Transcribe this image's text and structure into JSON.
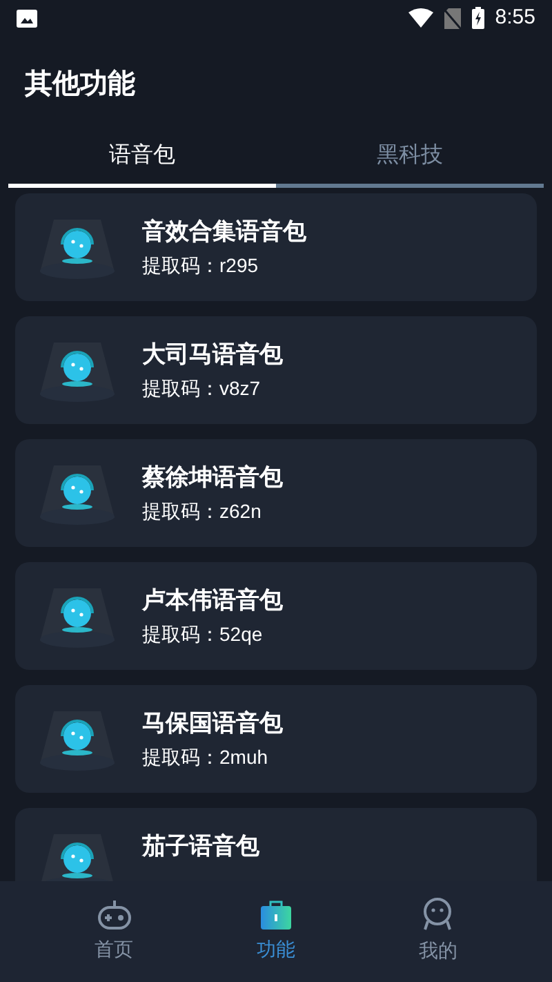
{
  "status_bar": {
    "time": "8:55"
  },
  "title": "其他功能",
  "tabs": [
    {
      "label": "语音包",
      "selected": true
    },
    {
      "label": "黑科技",
      "selected": false
    }
  ],
  "items": [
    {
      "name": "音效合集语音包",
      "code": "提取码：r295"
    },
    {
      "name": "大司马语音包",
      "code": "提取码：v8z7"
    },
    {
      "name": "蔡徐坤语音包",
      "code": "提取码：z62n"
    },
    {
      "name": "卢本伟语音包",
      "code": "提取码：52qe"
    },
    {
      "name": "马保国语音包",
      "code": "提取码：2muh"
    },
    {
      "name": "茄子语音包"
    }
  ],
  "nav": [
    {
      "label": "首页",
      "kind": "gamepad",
      "selected": false
    },
    {
      "label": "功能",
      "kind": "briefcase",
      "selected": true
    },
    {
      "label": "我的",
      "kind": "person",
      "selected": false
    }
  ]
}
